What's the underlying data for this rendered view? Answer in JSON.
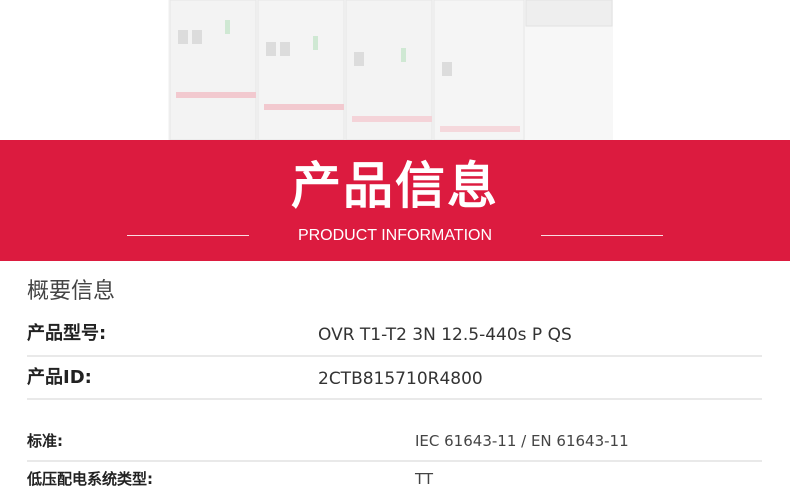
{
  "banner": {
    "title": "产品信息",
    "subtitle": "PRODUCT INFORMATION"
  },
  "colors": {
    "banner_red": "#dc1b3f",
    "divider": "#e9e9e9"
  },
  "summary": {
    "heading": "概要信息",
    "rows": [
      {
        "label": "产品型号:",
        "value": "OVR T1-T2 3N 12.5-440s P QS"
      },
      {
        "label": "产品ID:",
        "value": "2CTB815710R4800"
      }
    ]
  },
  "specs": {
    "rows": [
      {
        "label": "标准:",
        "value": "IEC 61643-11 / EN 61643-11"
      },
      {
        "label": "低压配电系统类型:",
        "value": "TT"
      }
    ]
  }
}
